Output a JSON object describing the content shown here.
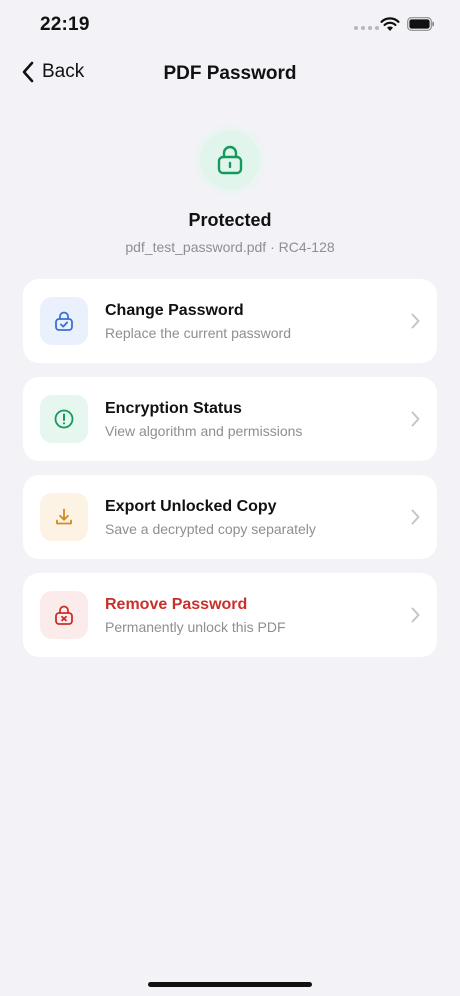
{
  "status_bar": {
    "time": "22:19",
    "icons": [
      "signal-dots-icon",
      "wifi-icon",
      "battery-icon"
    ]
  },
  "nav": {
    "back_label": "Back",
    "title": "PDF Password"
  },
  "hero": {
    "icon": "lock-icon",
    "status": "Protected",
    "file_info": "pdf_test_password.pdf · RC4-128"
  },
  "options": [
    {
      "title": "Change Password",
      "subtitle": "Replace the current password",
      "icon": "lock-check-icon",
      "icon_color": "#3a6fd8",
      "icon_bg": "#eaf1fd"
    },
    {
      "title": "Encryption Status",
      "subtitle": "View algorithm and permissions",
      "icon": "info-circle-icon",
      "icon_color": "#149a5b",
      "icon_bg": "#e6f7ef"
    },
    {
      "title": "Export Unlocked Copy",
      "subtitle": "Save a decrypted copy separately",
      "icon": "download-icon",
      "icon_color": "#d08a20",
      "icon_bg": "#fdf3e4"
    },
    {
      "title": "Remove Password",
      "subtitle": "Permanently unlock this PDF",
      "icon": "lock-x-icon",
      "icon_color": "#c9302c",
      "icon_bg": "#fcebeb"
    }
  ],
  "colors": {
    "background": "#f2f2f7",
    "accent_green": "#149a5b",
    "danger": "#c9302c",
    "secondary_text": "#8e8e93"
  }
}
